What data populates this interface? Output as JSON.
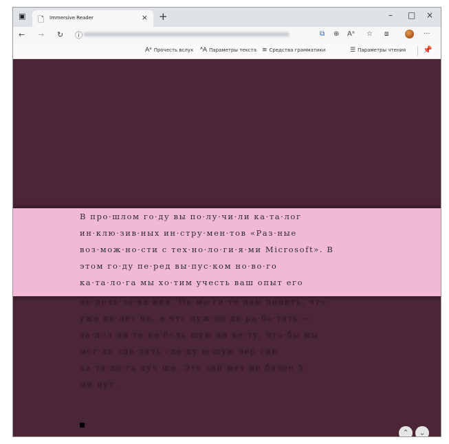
{
  "browser": {
    "tab_title": "Immersive Reader",
    "tab_close": "×",
    "new_tab": "+",
    "window_controls": {
      "minimize": "–",
      "maximize": "□",
      "close": "×"
    },
    "nav": {
      "back": "←",
      "forward": "→",
      "refresh": "↻",
      "info": "ⓘ"
    },
    "toolbar_icons": {
      "immersive_reader": "⧉",
      "zoom": "⊕",
      "read_aloud": "Aᵃ",
      "favorites": "☆",
      "collections": "⧈",
      "more": "···"
    }
  },
  "reader_toolbar": {
    "read_aloud": "Прочесть вслух",
    "text_prefs": "Параметры текста",
    "grammar_tools": "Средства грамматики",
    "reading_prefs": "Параметры чтения",
    "icons": {
      "read_aloud": "Aᵃ",
      "text_prefs": "ᴬA",
      "grammar": "≡",
      "reading": "☰",
      "pin": "📌"
    }
  },
  "content": {
    "highlighted_lines": [
      "В про·шлом го·ду вы по·лу·чи·ли ка·та·лог",
      "ин·клю·зив·ных ин·стру·мен·тов «Раз·ные",
      "воз·мож·но·сти с тех·но·ло·ги·я·ми Microsoft». В",
      "этом го·ду пе·ред вы·пус·ком но·во·го",
      "ка·та·ло·га мы хо·тим учесть ваш опыт его"
    ],
    "dimmed_lines": [
      "ис·поль·зо·ва·ния. По·мо·ги·те нам понять, что",
      "уже по·лез·но, а что нуж·но до·ра·бо·тать —",
      "за·пол·ни·те не·боль·шую ан·ке·ту, что·бы мы",
      "мог·ли сде·лать сле·ду·ю·щую вер·сию",
      "ка·та·ло·га луч·ше. Это зай·мет не более 5",
      "ми·нут."
    ]
  },
  "pager": {
    "up": "⌃",
    "down": "⌄"
  },
  "colors": {
    "page_bg": "#4a2636",
    "focus_band": "#f2b8d8",
    "title_bar": "#dfe3e8"
  }
}
